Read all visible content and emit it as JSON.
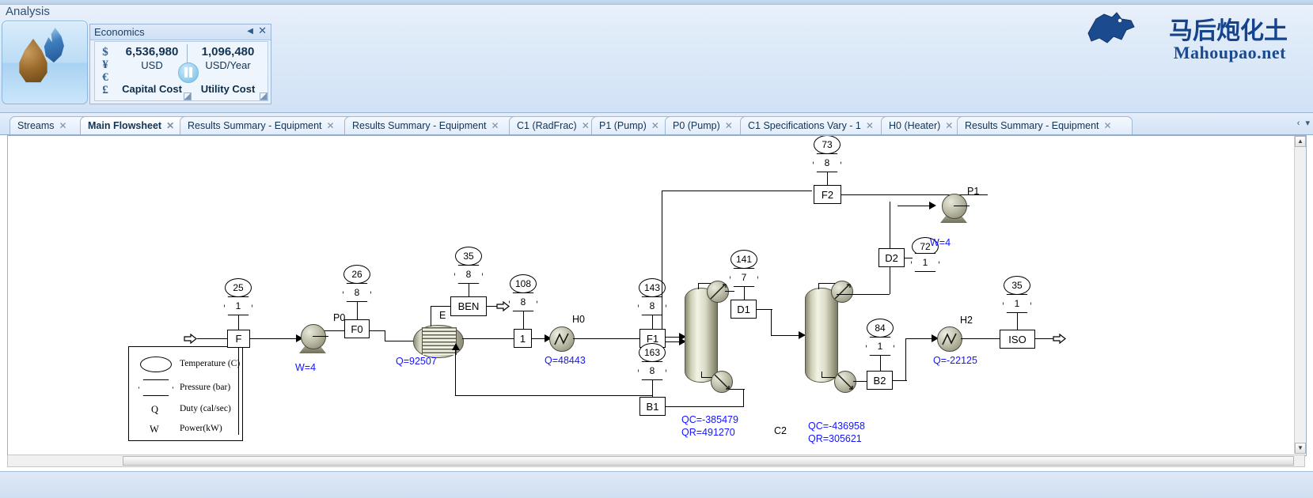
{
  "ribbon": {
    "analysis_label": "Analysis",
    "analysis_button_name": "energy-analysis-button"
  },
  "economics": {
    "title": "Economics",
    "collapse_icon": "◀",
    "close_icon": "✕",
    "currency_symbols": [
      "$",
      "¥",
      "€",
      "£"
    ],
    "capital": {
      "value": "6,536,980",
      "unit": "USD",
      "caption": "Capital Cost"
    },
    "utility": {
      "value": "1,096,480",
      "unit": "USD/Year",
      "caption": "Utility Cost"
    }
  },
  "watermark": {
    "chinese": "马后炮化土",
    "site": "Mahoupao.net"
  },
  "tabs": [
    {
      "label": "Streams",
      "active": false,
      "close": "✕"
    },
    {
      "label": "Main Flowsheet",
      "active": true,
      "close": "✕"
    },
    {
      "label": "Results Summary - Equipment",
      "active": false,
      "close": "✕"
    },
    {
      "label": "Results Summary - Equipment",
      "active": false,
      "close": "✕"
    },
    {
      "label": "C1 (RadFrac)",
      "active": false,
      "close": "✕"
    },
    {
      "label": "P1 (Pump)",
      "active": false,
      "close": "✕"
    },
    {
      "label": "P0 (Pump)",
      "active": false,
      "close": "✕"
    },
    {
      "label": "C1 Specifications Vary - 1",
      "active": false,
      "close": "✕"
    },
    {
      "label": "H0 (Heater)",
      "active": false,
      "close": "✕"
    },
    {
      "label": "Results Summary - Equipment",
      "active": false,
      "close": "✕"
    }
  ],
  "tab_scroll": {
    "left": "‹",
    "right": "›",
    "list": "▾"
  },
  "scrollbar": {
    "up": "▲",
    "down": "▼"
  },
  "legend": {
    "rows": [
      {
        "symbol": "oval",
        "text": "Temperature (C)"
      },
      {
        "symbol": "hex",
        "text": "Pressure (bar)"
      },
      {
        "symbol": "Q",
        "text": "Duty (cal/sec)"
      },
      {
        "symbol": "W",
        "text": "Power(kW)"
      }
    ]
  },
  "flowsheet": {
    "blocks": [
      {
        "id": "F",
        "label": "F"
      },
      {
        "id": "F0",
        "label": "F0"
      },
      {
        "id": "BEN",
        "label": "BEN"
      },
      {
        "id": "S1",
        "label": "1"
      },
      {
        "id": "F1",
        "label": "F1"
      },
      {
        "id": "B1",
        "label": "B1"
      },
      {
        "id": "D1",
        "label": "D1"
      },
      {
        "id": "F2",
        "label": "F2"
      },
      {
        "id": "D2",
        "label": "D2"
      },
      {
        "id": "B2",
        "label": "B2"
      },
      {
        "id": "ISO",
        "label": "ISO"
      }
    ],
    "unit_labels": [
      {
        "id": "P0",
        "label": "P0"
      },
      {
        "id": "E",
        "label": "E"
      },
      {
        "id": "H0",
        "label": "H0"
      },
      {
        "id": "C2",
        "label": "C2"
      },
      {
        "id": "P1",
        "label": "P1"
      },
      {
        "id": "H2",
        "label": "H2"
      }
    ],
    "temperatures": [
      {
        "id": "T-F",
        "value": "25"
      },
      {
        "id": "T-F0",
        "value": "26"
      },
      {
        "id": "T-BEN",
        "value": "35"
      },
      {
        "id": "T-S1",
        "value": "108"
      },
      {
        "id": "T-F1",
        "value": "143"
      },
      {
        "id": "T-B1",
        "value": "163"
      },
      {
        "id": "T-D1",
        "value": "141"
      },
      {
        "id": "T-F2",
        "value": "73"
      },
      {
        "id": "T-D2",
        "value": "72"
      },
      {
        "id": "T-B2",
        "value": "84"
      },
      {
        "id": "T-ISO",
        "value": "35"
      }
    ],
    "pressures": [
      {
        "id": "P-F",
        "value": "1"
      },
      {
        "id": "P-F0",
        "value": "8"
      },
      {
        "id": "P-BEN",
        "value": "8"
      },
      {
        "id": "P-S1",
        "value": "8"
      },
      {
        "id": "P-F1",
        "value": "8"
      },
      {
        "id": "P-B1",
        "value": "8"
      },
      {
        "id": "P-D1",
        "value": "7"
      },
      {
        "id": "P-F2",
        "value": "8"
      },
      {
        "id": "P-D2",
        "value": "1"
      },
      {
        "id": "P-B2",
        "value": "1"
      },
      {
        "id": "P-ISO",
        "value": "1"
      }
    ],
    "annotations": [
      {
        "id": "W-P0",
        "text": "W=4"
      },
      {
        "id": "Q-E",
        "text": "Q=92507"
      },
      {
        "id": "Q-H0",
        "text": "Q=48443"
      },
      {
        "id": "QC-C1",
        "text": "QC=-385479"
      },
      {
        "id": "QR-C1",
        "text": "QR=491270"
      },
      {
        "id": "QC-C2",
        "text": "QC=-436958"
      },
      {
        "id": "QR-C2",
        "text": "QR=305621"
      },
      {
        "id": "W-P1",
        "text": "W=4"
      },
      {
        "id": "Q-H2",
        "text": "Q=-22125"
      }
    ]
  }
}
